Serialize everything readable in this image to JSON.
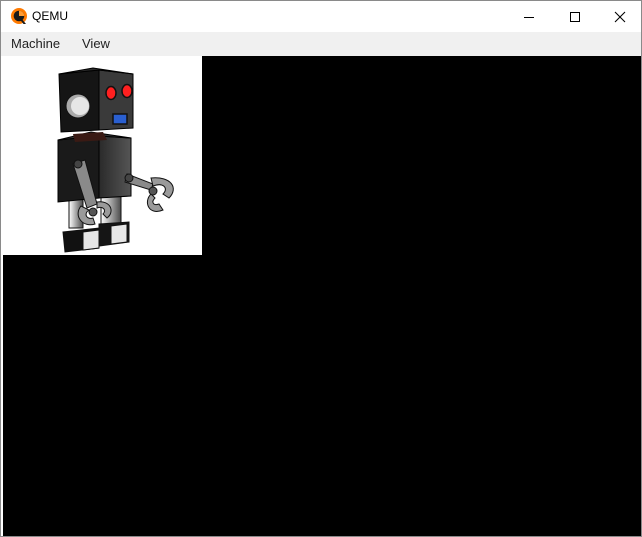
{
  "window": {
    "title": "QEMU",
    "icon": "qemu-logo-icon",
    "controls": [
      "minimize-icon",
      "maximize-icon",
      "close-icon"
    ]
  },
  "menubar": {
    "items": [
      {
        "label": "Machine"
      },
      {
        "label": "View"
      }
    ]
  },
  "display": {
    "background": "#000000",
    "guest_image": "robot-illustration"
  }
}
